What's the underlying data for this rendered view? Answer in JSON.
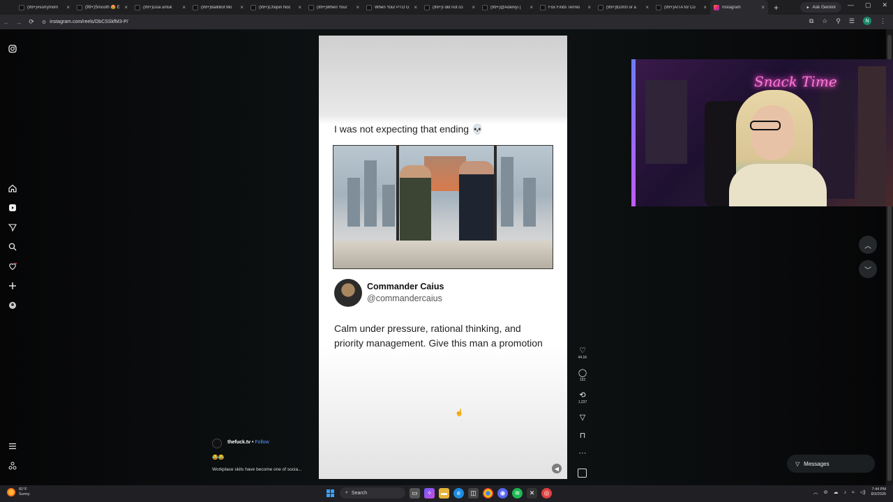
{
  "browser": {
    "tabs": [
      {
        "title": "(99+)#sorrymom",
        "active": false
      },
      {
        "title": "(99+)Smooth 🤩 E",
        "active": false
      },
      {
        "title": "(99+)Doa untuk ",
        "active": false
      },
      {
        "title": "(99+)BalliBot Mo",
        "active": false
      },
      {
        "title": "(99+)Chopin Noc",
        "active": false
      },
      {
        "title": "(99+)When Your",
        "active": false
      },
      {
        "title": "When Your PTO G",
        "active": false
      },
      {
        "title": "(99+)I did not co",
        "active": false
      },
      {
        "title": "(99+)@Adeniyi (",
        "active": false
      },
      {
        "title": "Fox Finds Tennis",
        "active": false
      },
      {
        "title": "(99+)$1000 or a",
        "active": false
      },
      {
        "title": "(99+)AITA for Co",
        "active": false
      },
      {
        "title": "Instagram",
        "active": true
      }
    ],
    "ask_gemini": "Ask Gemini",
    "url": "instagram.com/reels/DbCSSkfM3-P/",
    "profile_initial": "N"
  },
  "reel": {
    "header_text": "I was not expecting that ending 💀",
    "tweet": {
      "name": "Commander Caius",
      "handle": "@commandercaius",
      "text": "Calm under pressure, rational thinking, and priority management. Give this man a promotion"
    }
  },
  "post": {
    "username": "thefuck.tv",
    "separator": " • ",
    "follow": "Follow",
    "emoji": "😂😂",
    "caption": "Workplace skits have become one of socia..."
  },
  "actions": {
    "likes": "44.1K",
    "comments": "152",
    "reposts": "1,237"
  },
  "messages_label": "Messages",
  "webcam": {
    "neon_sign": "Snack Time"
  },
  "taskbar": {
    "temperature": "81°F",
    "condition": "Sunny",
    "search_label": "Search",
    "time": "7:44 PM",
    "date": "8/3/2026"
  },
  "colors": {
    "accent_follow": "#5b9bff",
    "neon": "#ff7ad9"
  }
}
